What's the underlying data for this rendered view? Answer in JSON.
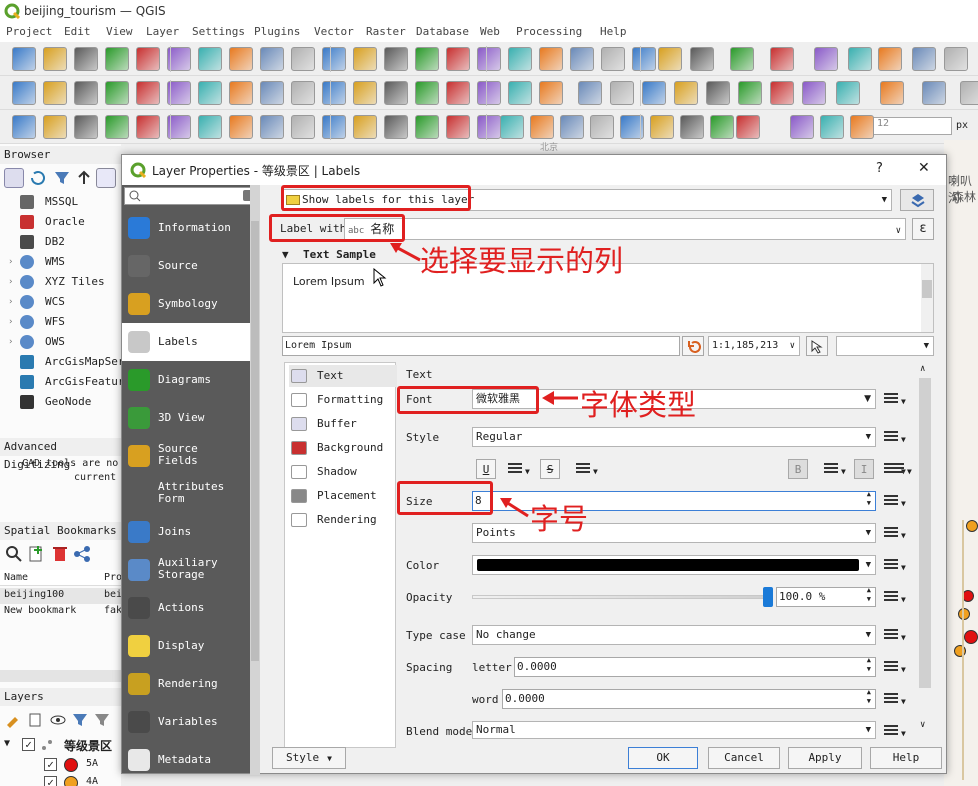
{
  "window": {
    "title": "beijing_tourism — QGIS"
  },
  "menu": [
    "Project",
    "Edit",
    "View",
    "Layer",
    "Settings",
    "Plugins",
    "Vector",
    "Raster",
    "Database",
    "Web",
    "Processing",
    "Help"
  ],
  "toolbar": {
    "scale_field": "12",
    "unit": "px"
  },
  "browser": {
    "title": "Browser",
    "items": [
      "MSSQL",
      "Oracle",
      "DB2",
      "WMS",
      "XYZ Tiles",
      "WCS",
      "WFS",
      "OWS",
      "ArcGisMapServ",
      "ArcGisFeature",
      "GeoNode"
    ]
  },
  "advanced_digitizing": {
    "title": "Advanced Digitizing",
    "text_line1": "CAD tools are no",
    "text_line2": "current"
  },
  "bookmarks": {
    "title": "Spatial Bookmarks",
    "col_name": "Name",
    "col_project": "Pro",
    "rows": [
      {
        "name": "beijing100",
        "project": "bei"
      },
      {
        "name": "New bookmark",
        "project": "fak"
      }
    ]
  },
  "layers": {
    "title": "Layers",
    "group": "等级景区",
    "items": [
      {
        "label": "5A",
        "color": "#e01010"
      },
      {
        "label": "4A",
        "color": "#f0a020"
      }
    ]
  },
  "map": {
    "label_line1": "喇叭沟",
    "label_line2": "森林",
    "label_bottom": "北京"
  },
  "dialog": {
    "title": "Layer Properties - 等级景区 | Labels",
    "help": "?",
    "close": "✕",
    "search_placeholder": "",
    "sidebar": [
      "Information",
      "Source",
      "Symbology",
      "Labels",
      "Diagrams",
      "3D View",
      "Source Fields",
      "Attributes Form",
      "Joins",
      "Auxiliary Storage",
      "Actions",
      "Display",
      "Rendering",
      "Variables",
      "Metadata"
    ],
    "sidebar_selected": "Labels",
    "label_mode": "Show labels for this layer",
    "label_with_caption": "Label with",
    "label_field": "名称",
    "label_field_prefix": "abc",
    "expression_btn": "ε",
    "text_sample_title": "Text Sample",
    "sample_text": "Lorem Ipsum",
    "sample_input": "Lorem Ipsum",
    "scale": "1:1,185,213",
    "subtabs": [
      "Text",
      "Formatting",
      "Buffer",
      "Background",
      "Shadow",
      "Placement",
      "Rendering"
    ],
    "section_title": "Text",
    "font_label": "Font",
    "font_value": "微软雅黑",
    "style_label": "Style",
    "style_value": "Regular",
    "underline": "U",
    "strike": "S",
    "bold": "B",
    "italic": "I",
    "size_label": "Size",
    "size_value": "8",
    "size_unit": "Points",
    "color_label": "Color",
    "color_value": "#000000",
    "opacity_label": "Opacity",
    "opacity_value": "100.0 %",
    "opacity_fraction": 1.0,
    "typecase_label": "Type case",
    "typecase_value": "No change",
    "spacing_label": "Spacing",
    "letter_label": "letter",
    "letter_value": "0.0000",
    "word_label": "word",
    "word_value": "0.0000",
    "blend_label": "Blend mode",
    "blend_value": "Normal",
    "style_btn": "Style",
    "ok": "OK",
    "cancel": "Cancel",
    "apply": "Apply",
    "help_btn": "Help"
  },
  "annotations": {
    "column": "选择要显示的列",
    "font": "字体类型",
    "size": "字号"
  }
}
